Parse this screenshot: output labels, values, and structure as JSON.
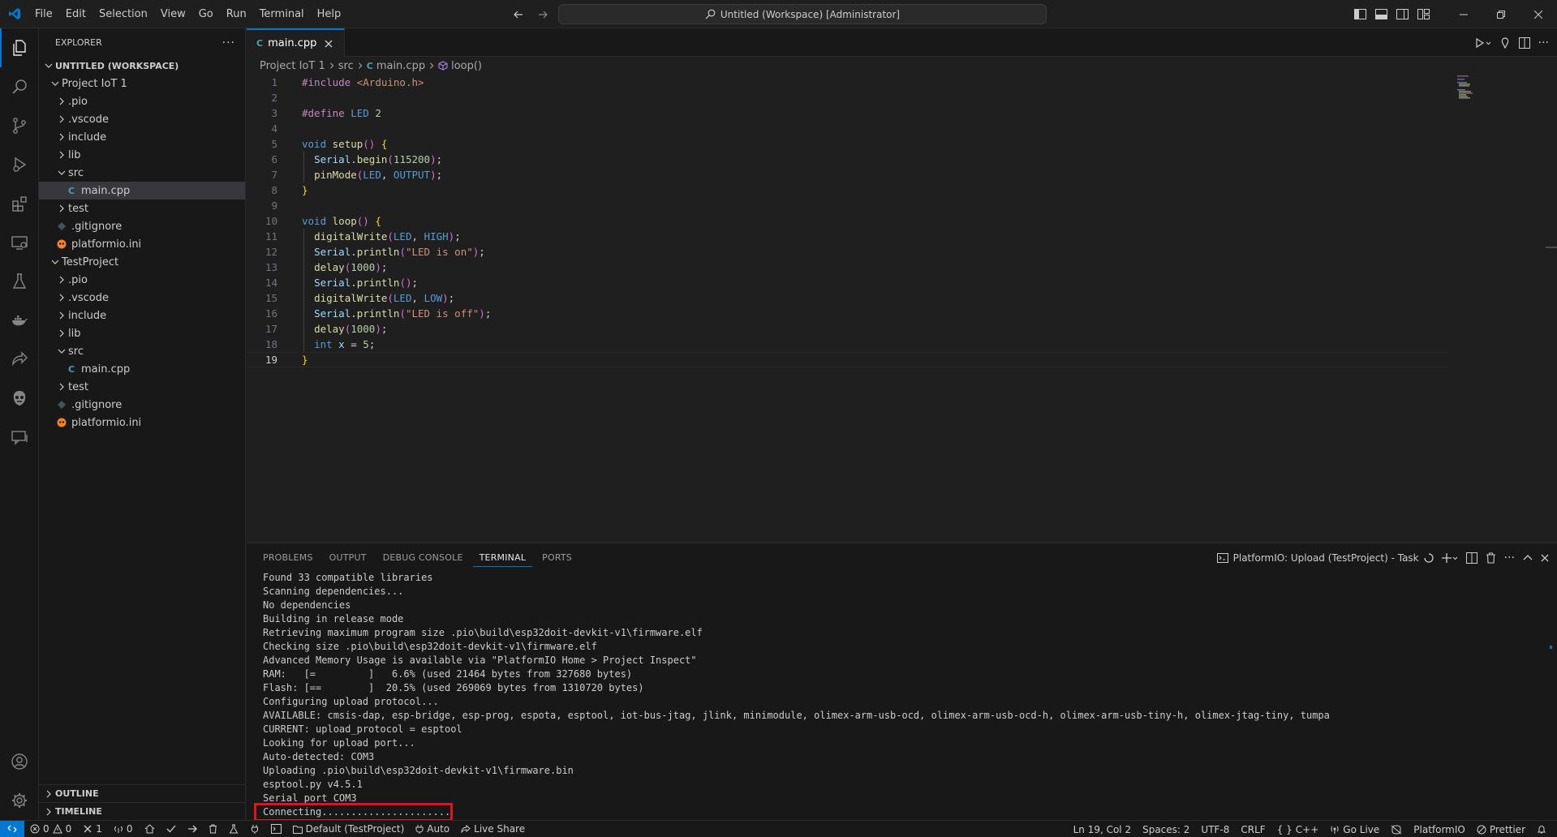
{
  "window": {
    "title": "Untitled (Workspace) [Administrator]"
  },
  "menu": [
    "File",
    "Edit",
    "Selection",
    "View",
    "Go",
    "Run",
    "Terminal",
    "Help"
  ],
  "explorer": {
    "title": "EXPLORER",
    "workspace": "UNTITLED (WORKSPACE)",
    "tree": [
      {
        "label": "Project IoT 1",
        "type": "root"
      },
      {
        "label": ".pio",
        "type": "folder"
      },
      {
        "label": ".vscode",
        "type": "folder"
      },
      {
        "label": "include",
        "type": "folder"
      },
      {
        "label": "lib",
        "type": "folder"
      },
      {
        "label": "src",
        "type": "folder-open"
      },
      {
        "label": "main.cpp",
        "type": "cpp"
      },
      {
        "label": "test",
        "type": "folder"
      },
      {
        "label": ".gitignore",
        "type": "git"
      },
      {
        "label": "platformio.ini",
        "type": "pio"
      },
      {
        "label": "TestProject",
        "type": "root"
      },
      {
        "label": ".pio",
        "type": "folder"
      },
      {
        "label": ".vscode",
        "type": "folder"
      },
      {
        "label": "include",
        "type": "folder"
      },
      {
        "label": "lib",
        "type": "folder"
      },
      {
        "label": "src",
        "type": "folder-open"
      },
      {
        "label": "main.cpp",
        "type": "cpp"
      },
      {
        "label": "test",
        "type": "folder"
      },
      {
        "label": ".gitignore",
        "type": "git"
      },
      {
        "label": "platformio.ini",
        "type": "pio"
      }
    ],
    "outline": "OUTLINE",
    "timeline": "TIMELINE"
  },
  "editor": {
    "tab": "main.cpp",
    "breadcrumb": [
      "Project IoT 1",
      "src",
      "main.cpp",
      "loop()"
    ],
    "current_line": 19,
    "lines": [
      "#include <Arduino.h>",
      "",
      "#define LED 2",
      "",
      "void setup() {",
      "  Serial.begin(115200);",
      "  pinMode(LED, OUTPUT);",
      "}",
      "",
      "void loop() {",
      "  digitalWrite(LED, HIGH);",
      "  Serial.println(\"LED is on\");",
      "  delay(1000);",
      "  Serial.println();",
      "  digitalWrite(LED, LOW);",
      "  Serial.println(\"LED is off\");",
      "  delay(1000);",
      "  int x = 5;",
      "}"
    ]
  },
  "panel": {
    "tabs": [
      "PROBLEMS",
      "OUTPUT",
      "DEBUG CONSOLE",
      "TERMINAL",
      "PORTS"
    ],
    "active_tab": "TERMINAL",
    "task": "PlatformIO: Upload (TestProject) - Task",
    "terminal_lines": [
      "Found 33 compatible libraries",
      "Scanning dependencies...",
      "No dependencies",
      "Building in release mode",
      "Retrieving maximum program size .pio\\build\\esp32doit-devkit-v1\\firmware.elf",
      "Checking size .pio\\build\\esp32doit-devkit-v1\\firmware.elf",
      "Advanced Memory Usage is available via \"PlatformIO Home > Project Inspect\"",
      "RAM:   [=         ]   6.6% (used 21464 bytes from 327680 bytes)",
      "Flash: [==        ]  20.5% (used 269069 bytes from 1310720 bytes)",
      "Configuring upload protocol...",
      "AVAILABLE: cmsis-dap, esp-bridge, esp-prog, espota, esptool, iot-bus-jtag, jlink, minimodule, olimex-arm-usb-ocd, olimex-arm-usb-ocd-h, olimex-arm-usb-tiny-h, olimex-jtag-tiny, tumpa",
      "CURRENT: upload_protocol = esptool",
      "Looking for upload port...",
      "Auto-detected: COM3",
      "Uploading .pio\\build\\esp32doit-devkit-v1\\firmware.bin",
      "esptool.py v4.5.1",
      "Serial port COM3",
      "Connecting......................"
    ]
  },
  "statusbar": {
    "errors": "0",
    "warnings": "0",
    "git": "1",
    "ports": "0",
    "env": "Default (TestProject)",
    "auto": "Auto",
    "live_share": "Live Share",
    "position": "Ln 19, Col 2",
    "spaces": "Spaces: 2",
    "encoding": "UTF-8",
    "eol": "CRLF",
    "language": "C++",
    "go_live": "Go Live",
    "platformio": "PlatformIO",
    "prettier": "Prettier"
  },
  "colors": {
    "accent": "#0078d4",
    "highlight_box": "#e0151b"
  }
}
